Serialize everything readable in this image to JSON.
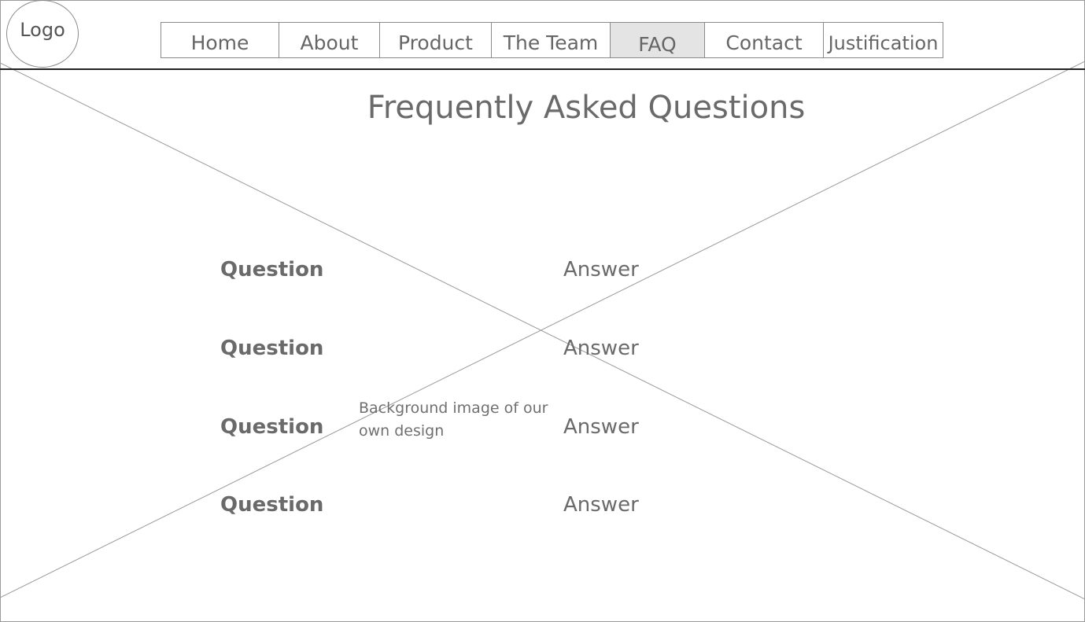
{
  "header": {
    "logo_label": "Logo",
    "nav": [
      {
        "label": "Home",
        "active": false
      },
      {
        "label": "About",
        "active": false
      },
      {
        "label": "Product",
        "active": false
      },
      {
        "label": "The Team",
        "active": false
      },
      {
        "label": "FAQ",
        "active": true
      },
      {
        "label": "Contact",
        "active": false
      },
      {
        "label": "Justification",
        "active": false
      }
    ]
  },
  "main": {
    "title": "Frequently Asked Questions",
    "faq": [
      {
        "question": "Question",
        "answer": "Answer"
      },
      {
        "question": "Question",
        "answer": "Answer"
      },
      {
        "question": "Question",
        "answer": "Answer"
      },
      {
        "question": "Question",
        "answer": "Answer"
      }
    ],
    "background_note": "Background image of our own design"
  },
  "colors": {
    "active_tab_bg": "#e4e4e4",
    "text": "#6a6a6a",
    "border": "#8a8a8a"
  }
}
